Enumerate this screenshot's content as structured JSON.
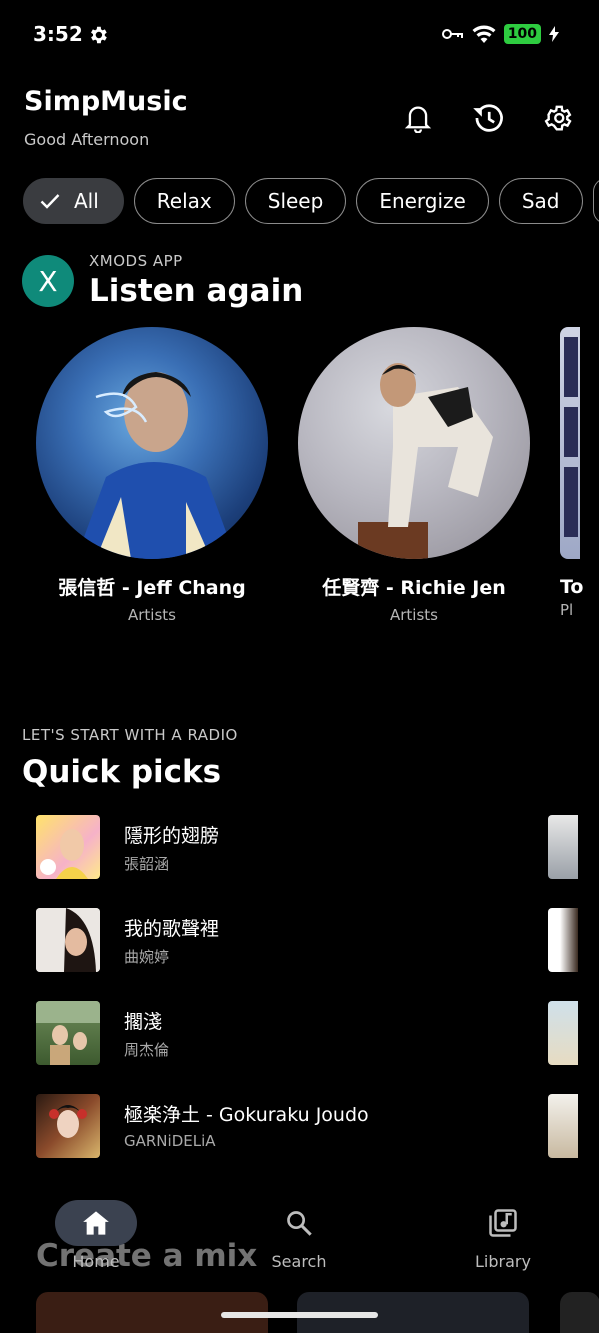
{
  "status_bar": {
    "time": "3:52",
    "battery": "100"
  },
  "header": {
    "app_name": "SimpMusic",
    "greeting": "Good Afternoon"
  },
  "chips": [
    "All",
    "Relax",
    "Sleep",
    "Energize",
    "Sad",
    "F"
  ],
  "listen_again": {
    "avatar_letter": "X",
    "subtitle": "XMODS APP",
    "title": "Listen again",
    "items": [
      {
        "name": "張信哲 - Jeff Chang",
        "type": "Artists"
      },
      {
        "name": "任賢齊 - Richie Jen",
        "type": "Artists"
      },
      {
        "name": "To",
        "type": "Pl"
      }
    ]
  },
  "quick_picks": {
    "subtitle": "LET'S START WITH A RADIO",
    "title": "Quick picks",
    "items": [
      {
        "title": "隱形的翅膀",
        "artist": "張韶涵"
      },
      {
        "title": "我的歌聲裡",
        "artist": "曲婉婷"
      },
      {
        "title": "擱淺",
        "artist": "周杰倫"
      },
      {
        "title": "極楽浄土 - Gokuraku Joudo",
        "artist": "GARNiDELiA"
      }
    ]
  },
  "create_mix": {
    "title": "Create a mix"
  },
  "bottom_nav": {
    "home": "Home",
    "search": "Search",
    "library": "Library"
  },
  "colors": {
    "background": "#000000",
    "avatar": "#0f8a7a",
    "battery": "#2ecc40",
    "nav_active": "#3b4250"
  }
}
